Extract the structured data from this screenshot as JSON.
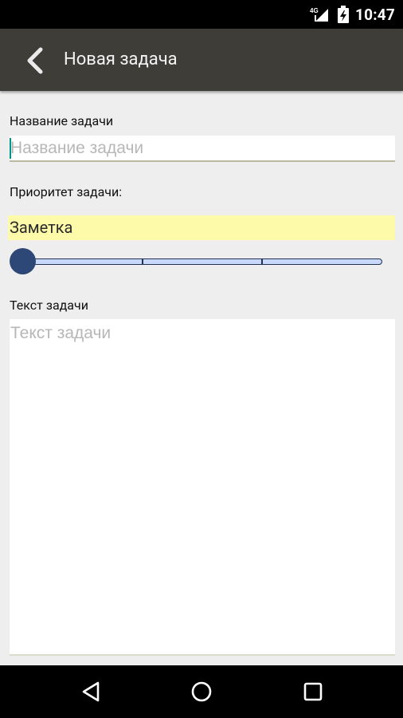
{
  "status_bar": {
    "network": "4G",
    "time": "10:47",
    "icons": [
      "signal-icon",
      "battery-icon"
    ]
  },
  "app_bar": {
    "title": "Новая задача",
    "back_icon": "chevron-left-icon"
  },
  "form": {
    "title_label": "Название задачи",
    "title_placeholder": "Название задачи",
    "title_value": "",
    "priority_label": "Приоритет задачи:",
    "priority_value": "Заметка",
    "priority_slider": {
      "value": 0,
      "max": 3
    },
    "text_label": "Текст задачи",
    "text_placeholder": "Текст задачи",
    "text_value": ""
  },
  "nav_bar": {
    "icons": [
      "back-triangle-icon",
      "home-circle-icon",
      "recents-square-icon"
    ]
  },
  "colors": {
    "app_bar": "#3e3d38",
    "priority_background": "#fdfaaa",
    "slider_thumb": "#2d4776",
    "slider_track": "#c7d8fb",
    "caret": "#009688"
  }
}
